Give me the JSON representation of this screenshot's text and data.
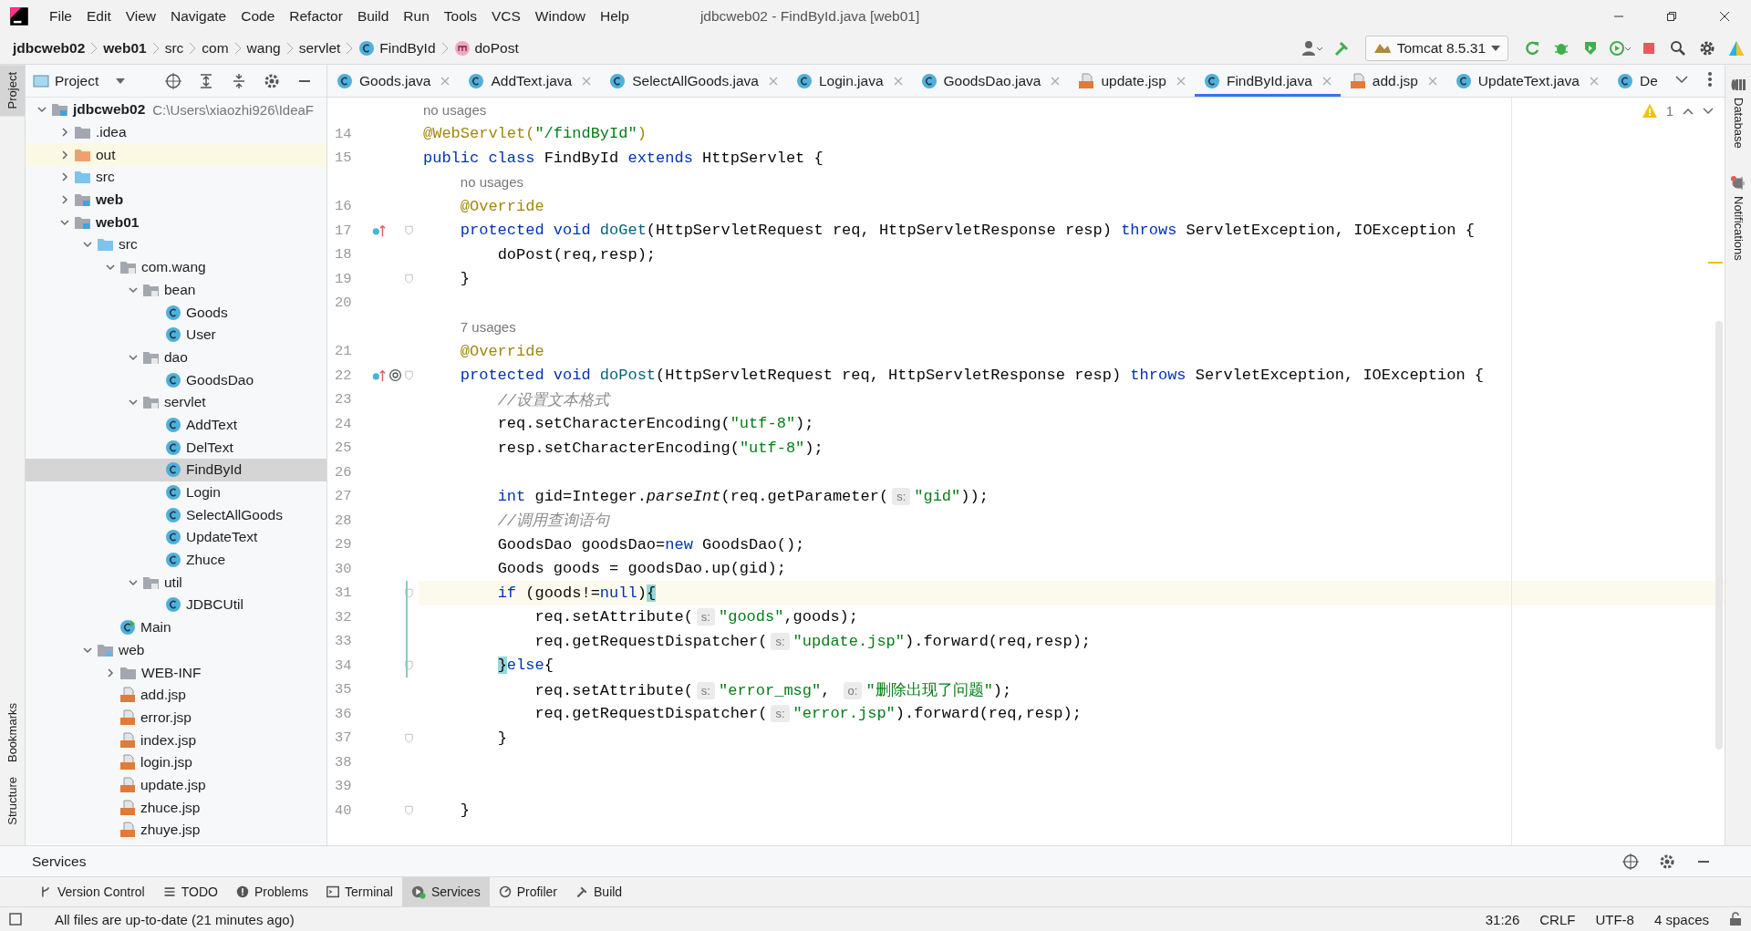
{
  "app": {
    "title": "jdbcweb02 - FindById.java [web01]",
    "menu": [
      "File",
      "Edit",
      "View",
      "Navigate",
      "Code",
      "Refactor",
      "Build",
      "Run",
      "Tools",
      "VCS",
      "Window",
      "Help"
    ]
  },
  "breadcrumbs": [
    {
      "label": "jdbcweb02",
      "kind": "bold"
    },
    {
      "label": "web01",
      "kind": "bold"
    },
    {
      "label": "src",
      "kind": "plain"
    },
    {
      "label": "com",
      "kind": "plain"
    },
    {
      "label": "wang",
      "kind": "plain"
    },
    {
      "label": "servlet",
      "kind": "plain"
    },
    {
      "label": "FindById",
      "kind": "class"
    },
    {
      "label": "doPost",
      "kind": "method"
    }
  ],
  "run_config": "Tomcat 8.5.31",
  "left_stripe": [
    {
      "label": "Project",
      "selected": true
    },
    {
      "label": "Bookmarks",
      "selected": false
    },
    {
      "label": "Structure",
      "selected": false
    }
  ],
  "right_stripe": [
    {
      "label": "Database",
      "kind": "database"
    },
    {
      "label": "Notifications",
      "kind": "bell"
    }
  ],
  "project": {
    "title": "Project",
    "tree": [
      {
        "label": "jdbcweb02",
        "kind": "module",
        "bold": true,
        "note": "C:\\Users\\xiaozhi926\\IdeaF",
        "expanded": true,
        "selected": false,
        "children": [
          {
            "label": ".idea",
            "kind": "folder",
            "bold": false,
            "expanded": false,
            "selected": false
          },
          {
            "label": "out",
            "kind": "excluded",
            "bold": false,
            "expanded": false,
            "selected": false
          },
          {
            "label": "src",
            "kind": "source",
            "bold": false,
            "expanded": false,
            "selected": false
          },
          {
            "label": "web",
            "kind": "module",
            "bold": true,
            "expanded": false,
            "selected": false
          },
          {
            "label": "web01",
            "kind": "module",
            "bold": true,
            "expanded": true,
            "selected": false,
            "children": [
              {
                "label": "src",
                "kind": "source",
                "bold": false,
                "expanded": true,
                "selected": false,
                "children": [
                  {
                    "label": "com.wang",
                    "kind": "package",
                    "bold": false,
                    "expanded": true,
                    "selected": false,
                    "children": [
                      {
                        "label": "bean",
                        "kind": "package",
                        "bold": false,
                        "expanded": true,
                        "selected": false,
                        "children": [
                          {
                            "label": "Goods",
                            "kind": "class",
                            "bold": false,
                            "selected": false
                          },
                          {
                            "label": "User",
                            "kind": "class",
                            "bold": false,
                            "selected": false
                          }
                        ]
                      },
                      {
                        "label": "dao",
                        "kind": "package",
                        "bold": false,
                        "expanded": true,
                        "selected": false,
                        "children": [
                          {
                            "label": "GoodsDao",
                            "kind": "class",
                            "bold": false,
                            "selected": false
                          }
                        ]
                      },
                      {
                        "label": "servlet",
                        "kind": "package",
                        "bold": false,
                        "expanded": true,
                        "selected": false,
                        "children": [
                          {
                            "label": "AddText",
                            "kind": "class",
                            "bold": false,
                            "selected": false
                          },
                          {
                            "label": "DelText",
                            "kind": "class",
                            "bold": false,
                            "selected": false
                          },
                          {
                            "label": "FindById",
                            "kind": "class",
                            "bold": false,
                            "selected": true
                          },
                          {
                            "label": "Login",
                            "kind": "class",
                            "bold": false,
                            "selected": false
                          },
                          {
                            "label": "SelectAllGoods",
                            "kind": "class",
                            "bold": false,
                            "selected": false
                          },
                          {
                            "label": "UpdateText",
                            "kind": "class",
                            "bold": false,
                            "selected": false
                          },
                          {
                            "label": "Zhuce",
                            "kind": "class",
                            "bold": false,
                            "selected": false
                          }
                        ]
                      },
                      {
                        "label": "util",
                        "kind": "package",
                        "bold": false,
                        "expanded": true,
                        "selected": false,
                        "children": [
                          {
                            "label": "JDBCUtil",
                            "kind": "class",
                            "bold": false,
                            "selected": false
                          }
                        ]
                      }
                    ]
                  },
                  {
                    "label": "Main",
                    "kind": "main",
                    "bold": false,
                    "selected": false
                  }
                ]
              },
              {
                "label": "web",
                "kind": "webfolder",
                "bold": false,
                "expanded": true,
                "selected": false,
                "children": [
                  {
                    "label": "WEB-INF",
                    "kind": "folder",
                    "bold": false,
                    "expanded": false,
                    "selected": false
                  },
                  {
                    "label": "add.jsp",
                    "kind": "jsp",
                    "bold": false,
                    "selected": false
                  },
                  {
                    "label": "error.jsp",
                    "kind": "jsp",
                    "bold": false,
                    "selected": false
                  },
                  {
                    "label": "index.jsp",
                    "kind": "jsp",
                    "bold": false,
                    "selected": false
                  },
                  {
                    "label": "login.jsp",
                    "kind": "jsp",
                    "bold": false,
                    "selected": false
                  },
                  {
                    "label": "update.jsp",
                    "kind": "jsp",
                    "bold": false,
                    "selected": false
                  },
                  {
                    "label": "zhuce.jsp",
                    "kind": "jsp",
                    "bold": false,
                    "selected": false
                  },
                  {
                    "label": "zhuye.jsp",
                    "kind": "jsp",
                    "bold": false,
                    "selected": false
                  }
                ]
              }
            ]
          }
        ]
      }
    ]
  },
  "tabs": [
    {
      "label": "Goods.java",
      "kind": "java",
      "selected": false
    },
    {
      "label": "AddText.java",
      "kind": "java",
      "selected": false
    },
    {
      "label": "SelectAllGoods.java",
      "kind": "java",
      "selected": false
    },
    {
      "label": "Login.java",
      "kind": "java",
      "selected": false
    },
    {
      "label": "GoodsDao.java",
      "kind": "java",
      "selected": false
    },
    {
      "label": "update.jsp",
      "kind": "jsp",
      "selected": false
    },
    {
      "label": "FindById.java",
      "kind": "java",
      "selected": true
    },
    {
      "label": "add.jsp",
      "kind": "jsp",
      "selected": false
    },
    {
      "label": "UpdateText.java",
      "kind": "java",
      "selected": false
    },
    {
      "label": "De",
      "kind": "cut",
      "selected": false
    }
  ],
  "warnings": "1",
  "code": [
    {
      "kind": "usage",
      "text": "no usages"
    },
    {
      "kind": "code",
      "number": "14",
      "current": false,
      "fold": false,
      "changed": false,
      "override": false,
      "at_sign": false,
      "tokens": [
        {
          "kind": "ann",
          "text": "@WebServlet("
        },
        {
          "kind": "str",
          "text": "\"/findById\""
        },
        {
          "kind": "ann",
          "text": ")"
        }
      ]
    },
    {
      "kind": "code",
      "number": "15",
      "current": false,
      "fold": false,
      "changed": false,
      "override": false,
      "at_sign": false,
      "tokens": [
        {
          "kind": "kw",
          "text": "public class "
        },
        {
          "kind": "p",
          "text": "FindById "
        },
        {
          "kind": "kw",
          "text": "extends "
        },
        {
          "kind": "p",
          "text": "HttpServlet {"
        }
      ]
    },
    {
      "kind": "usage",
      "text": "no usages"
    },
    {
      "kind": "code",
      "number": "16",
      "current": false,
      "fold": false,
      "changed": false,
      "override": false,
      "at_sign": false,
      "tokens": [
        {
          "kind": "ann",
          "text": "    @Override"
        }
      ]
    },
    {
      "kind": "code",
      "number": "17",
      "current": false,
      "fold": true,
      "changed": false,
      "override": true,
      "at_sign": false,
      "tokens": [
        {
          "kind": "kw",
          "text": "    protected void "
        },
        {
          "kind": "fn",
          "text": "doGet"
        },
        {
          "kind": "p",
          "text": "(HttpServletRequest req, HttpServletResponse resp) "
        },
        {
          "kind": "kw",
          "text": "throws "
        },
        {
          "kind": "p",
          "text": "ServletException, IOException {"
        }
      ]
    },
    {
      "kind": "code",
      "number": "18",
      "current": false,
      "fold": false,
      "changed": false,
      "override": false,
      "at_sign": false,
      "tokens": [
        {
          "kind": "p",
          "text": "        doPost(req,resp);"
        }
      ]
    },
    {
      "kind": "code",
      "number": "19",
      "current": false,
      "fold": true,
      "changed": false,
      "override": false,
      "at_sign": false,
      "tokens": [
        {
          "kind": "p",
          "text": "    }"
        }
      ]
    },
    {
      "kind": "code",
      "number": "20",
      "current": false,
      "fold": false,
      "changed": false,
      "override": false,
      "at_sign": false
    },
    {
      "kind": "usage",
      "text": "7 usages"
    },
    {
      "kind": "code",
      "number": "21",
      "current": false,
      "fold": false,
      "changed": false,
      "override": false,
      "at_sign": false,
      "tokens": [
        {
          "kind": "ann",
          "text": "    @Override"
        }
      ]
    },
    {
      "kind": "code",
      "number": "22",
      "current": false,
      "fold": true,
      "changed": false,
      "override": true,
      "at_sign": true,
      "tokens": [
        {
          "kind": "kw",
          "text": "    protected void "
        },
        {
          "kind": "fn",
          "text": "doPost"
        },
        {
          "kind": "p",
          "text": "(HttpServletRequest req, HttpServletResponse resp) "
        },
        {
          "kind": "kw",
          "text": "throws "
        },
        {
          "kind": "p",
          "text": "ServletException, IOException {"
        }
      ]
    },
    {
      "kind": "code",
      "number": "23",
      "current": false,
      "fold": false,
      "changed": false,
      "override": false,
      "at_sign": false,
      "tokens": [
        {
          "kind": "cm",
          "text": "        //设置文本格式"
        }
      ]
    },
    {
      "kind": "code",
      "number": "24",
      "current": false,
      "fold": false,
      "changed": false,
      "override": false,
      "at_sign": false,
      "tokens": [
        {
          "kind": "p",
          "text": "        req.setCharacterEncoding("
        },
        {
          "kind": "str",
          "text": "\"utf-8\""
        },
        {
          "kind": "p",
          "text": ");"
        }
      ]
    },
    {
      "kind": "code",
      "number": "25",
      "current": false,
      "fold": false,
      "changed": false,
      "override": false,
      "at_sign": false,
      "tokens": [
        {
          "kind": "p",
          "text": "        resp.setCharacterEncoding("
        },
        {
          "kind": "str",
          "text": "\"utf-8\""
        },
        {
          "kind": "p",
          "text": ");"
        }
      ]
    },
    {
      "kind": "code",
      "number": "26",
      "current": false,
      "fold": false,
      "changed": false,
      "override": false,
      "at_sign": false
    },
    {
      "kind": "code",
      "number": "27",
      "current": false,
      "fold": false,
      "changed": false,
      "override": false,
      "at_sign": false,
      "tokens": [
        {
          "kind": "kw",
          "text": "        int "
        },
        {
          "kind": "p",
          "text": "gid=Integer."
        },
        {
          "kind": "it",
          "text": "parseInt"
        },
        {
          "kind": "p",
          "text": "(req.getParameter("
        },
        {
          "kind": "hint",
          "text": "s:"
        },
        {
          "kind": "str",
          "text": "\"gid\""
        },
        {
          "kind": "p",
          "text": "));"
        }
      ]
    },
    {
      "kind": "code",
      "number": "28",
      "current": false,
      "fold": false,
      "changed": false,
      "override": false,
      "at_sign": false,
      "tokens": [
        {
          "kind": "cm",
          "text": "        //调用查询语句"
        }
      ]
    },
    {
      "kind": "code",
      "number": "29",
      "current": false,
      "fold": false,
      "changed": false,
      "override": false,
      "at_sign": false,
      "tokens": [
        {
          "kind": "p",
          "text": "        GoodsDao goodsDao="
        },
        {
          "kind": "kw",
          "text": "new "
        },
        {
          "kind": "p",
          "text": "GoodsDao();"
        }
      ]
    },
    {
      "kind": "code",
      "number": "30",
      "current": false,
      "fold": false,
      "changed": false,
      "override": false,
      "at_sign": false,
      "tokens": [
        {
          "kind": "p",
          "text": "        Goods goods = goodsDao.up(gid);"
        }
      ]
    },
    {
      "kind": "code",
      "number": "31",
      "current": true,
      "fold": true,
      "changed": true,
      "override": false,
      "at_sign": false,
      "tokens": [
        {
          "kind": "kw",
          "text": "        if "
        },
        {
          "kind": "p",
          "text": "(goods!="
        },
        {
          "kind": "kw",
          "text": "null"
        },
        {
          "kind": "p",
          "text": ")"
        },
        {
          "kind": "brace",
          "text": "{"
        }
      ]
    },
    {
      "kind": "code",
      "number": "32",
      "current": false,
      "fold": false,
      "changed": true,
      "override": false,
      "at_sign": false,
      "tokens": [
        {
          "kind": "p",
          "text": "            req.setAttribute("
        },
        {
          "kind": "hint",
          "text": "s:"
        },
        {
          "kind": "str",
          "text": "\"goods\""
        },
        {
          "kind": "p",
          "text": ",goods);"
        }
      ]
    },
    {
      "kind": "code",
      "number": "33",
      "current": false,
      "fold": false,
      "changed": true,
      "override": false,
      "at_sign": false,
      "tokens": [
        {
          "kind": "p",
          "text": "            req.getRequestDispatcher("
        },
        {
          "kind": "hint",
          "text": "s:"
        },
        {
          "kind": "str",
          "text": "\"update.jsp\""
        },
        {
          "kind": "p",
          "text": ").forward(req,resp);"
        }
      ]
    },
    {
      "kind": "code",
      "number": "34",
      "current": false,
      "fold": true,
      "changed": true,
      "override": false,
      "at_sign": false,
      "tokens": [
        {
          "kind": "brace",
          "text": "        }"
        },
        {
          "kind": "kw",
          "text": "else"
        },
        {
          "kind": "p",
          "text": "{"
        }
      ]
    },
    {
      "kind": "code",
      "number": "35",
      "current": false,
      "fold": false,
      "changed": false,
      "override": false,
      "at_sign": false,
      "tokens": [
        {
          "kind": "p",
          "text": "            req.setAttribute("
        },
        {
          "kind": "hint",
          "text": "s:"
        },
        {
          "kind": "str",
          "text": "\"error_msg\""
        },
        {
          "kind": "p",
          "text": ", "
        },
        {
          "kind": "hint",
          "text": "o:"
        },
        {
          "kind": "str",
          "text": "\"删除出现了问题\""
        },
        {
          "kind": "p",
          "text": ");"
        }
      ]
    },
    {
      "kind": "code",
      "number": "36",
      "current": false,
      "fold": false,
      "changed": false,
      "override": false,
      "at_sign": false,
      "tokens": [
        {
          "kind": "p",
          "text": "            req.getRequestDispatcher("
        },
        {
          "kind": "hint",
          "text": "s:"
        },
        {
          "kind": "str",
          "text": "\"error.jsp\""
        },
        {
          "kind": "p",
          "text": ").forward(req,resp);"
        }
      ]
    },
    {
      "kind": "code",
      "number": "37",
      "current": false,
      "fold": true,
      "changed": false,
      "override": false,
      "at_sign": false,
      "tokens": [
        {
          "kind": "p",
          "text": "        }"
        }
      ]
    },
    {
      "kind": "code",
      "number": "38",
      "current": false,
      "fold": false,
      "changed": false,
      "override": false,
      "at_sign": false
    },
    {
      "kind": "code",
      "number": "39",
      "current": false,
      "fold": false,
      "changed": false,
      "override": false,
      "at_sign": false
    },
    {
      "kind": "code",
      "number": "40",
      "current": false,
      "fold": true,
      "changed": false,
      "override": false,
      "at_sign": false,
      "tokens": [
        {
          "kind": "p",
          "text": "    }"
        }
      ]
    }
  ],
  "services": {
    "title": "Services"
  },
  "tool_tabs": [
    {
      "label": "Version Control",
      "kind": "vcs",
      "selected": false
    },
    {
      "label": "TODO",
      "kind": "todo",
      "selected": false
    },
    {
      "label": "Problems",
      "kind": "problems",
      "selected": false
    },
    {
      "label": "Terminal",
      "kind": "terminal",
      "selected": false
    },
    {
      "label": "Services",
      "kind": "services",
      "selected": true
    },
    {
      "label": "Profiler",
      "kind": "profiler",
      "selected": false
    },
    {
      "label": "Build",
      "kind": "build",
      "selected": false
    }
  ],
  "status": {
    "message": "All files are up-to-date (21 minutes ago)",
    "items": [
      "31:26",
      "CRLF",
      "UTF-8",
      "4 spaces"
    ]
  }
}
